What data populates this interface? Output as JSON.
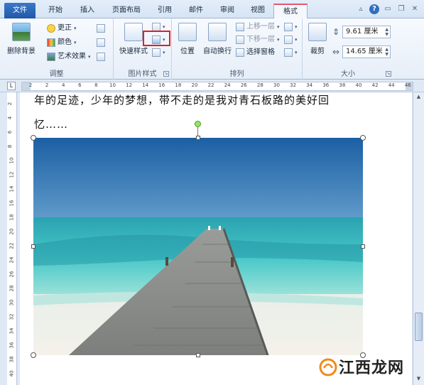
{
  "tabs": {
    "file": "文件",
    "items": [
      "开始",
      "插入",
      "页面布局",
      "引用",
      "邮件",
      "审阅",
      "视图",
      "格式"
    ],
    "active": "格式"
  },
  "ribbon": {
    "adjust": {
      "label": "调整",
      "remove_bg": "删除背景",
      "corrections": "更正",
      "color": "颜色",
      "artistic": "艺术效果"
    },
    "picture_styles": {
      "label": "图片样式",
      "quick_styles": "快速样式"
    },
    "arrange": {
      "label": "排列",
      "position": "位置",
      "wrap_text": "自动换行",
      "bring_forward": "上移一层",
      "send_backward": "下移一层",
      "selection_pane": "选择窗格"
    },
    "size": {
      "label": "大小",
      "crop": "裁剪",
      "height": "9.61 厘米",
      "width": "14.65 厘米"
    }
  },
  "ruler": {
    "corner": "L",
    "h_ticks": [
      "2",
      "2",
      "4",
      "6",
      "8",
      "10",
      "12",
      "14",
      "16",
      "18",
      "20",
      "22",
      "24",
      "26",
      "28",
      "30",
      "32",
      "34",
      "36",
      "38",
      "40",
      "42",
      "44",
      "46"
    ],
    "v_ticks": [
      "2",
      "4",
      "6",
      "8",
      "10",
      "12",
      "14",
      "16",
      "18",
      "20",
      "22",
      "24",
      "26",
      "28",
      "30",
      "32",
      "34",
      "36",
      "38",
      "40"
    ]
  },
  "document": {
    "line1": "年的足迹，少年的梦想，带不走的是我对青石板路的美好回",
    "line2": "忆……"
  },
  "watermark": {
    "text": "江西龙网"
  },
  "colors": {
    "tab_accent": "#e8566b",
    "file_tab": "#2a62b4",
    "highlight": "#e02020",
    "rotation_handle": "#9be26a"
  }
}
